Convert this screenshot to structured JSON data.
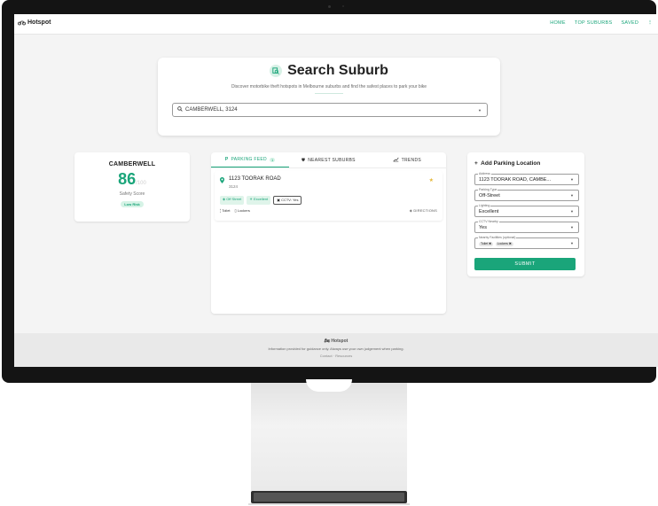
{
  "app": {
    "brand": "Hotspot",
    "nav": [
      "HOME",
      "TOP SUBURBS",
      "SAVED",
      "⋮"
    ]
  },
  "search": {
    "title": "Search Suburb",
    "subtitle": "Discover motorbike theft hotspots in Melbourne suburbs and find the safest places to park your bike",
    "value": "CAMBERWELL, 3124"
  },
  "score": {
    "suburb": "CAMBERWELL",
    "value": "86",
    "max": "/100",
    "label": "Safety Score",
    "risk": "Low Risk"
  },
  "feed": {
    "tabs": [
      {
        "label": "PARKING FEED",
        "count": "1"
      },
      {
        "label": "NEAREST SUBURBS"
      },
      {
        "label": "TRENDS"
      }
    ],
    "item": {
      "address": "1123 TOORAK ROAD",
      "postcode": "3124",
      "chips": [
        "Off Street",
        "Excellent",
        "CCTV: Yes"
      ],
      "facilities": [
        "Toilet",
        "Lockers"
      ],
      "directions": "DIRECTIONS"
    }
  },
  "add": {
    "title": "Add Parking Location",
    "fields": [
      {
        "label": "Address",
        "value": "1123 TOORAK ROAD, CAMBE..."
      },
      {
        "label": "Parking Type",
        "value": "Off-Street"
      },
      {
        "label": "Lighting",
        "value": "Excellent"
      },
      {
        "label": "CCTV Nearby",
        "value": "Yes"
      },
      {
        "label": "Nearby Facilities (optional)",
        "chips": [
          "Toilet",
          "Lockers"
        ]
      }
    ],
    "submit": "SUBMIT"
  },
  "footer": {
    "brand": "Hotspot",
    "disclaimer": "Information provided for guidance only. Always use your own judgement when parking.",
    "links": "Contact  ·  Resources"
  }
}
